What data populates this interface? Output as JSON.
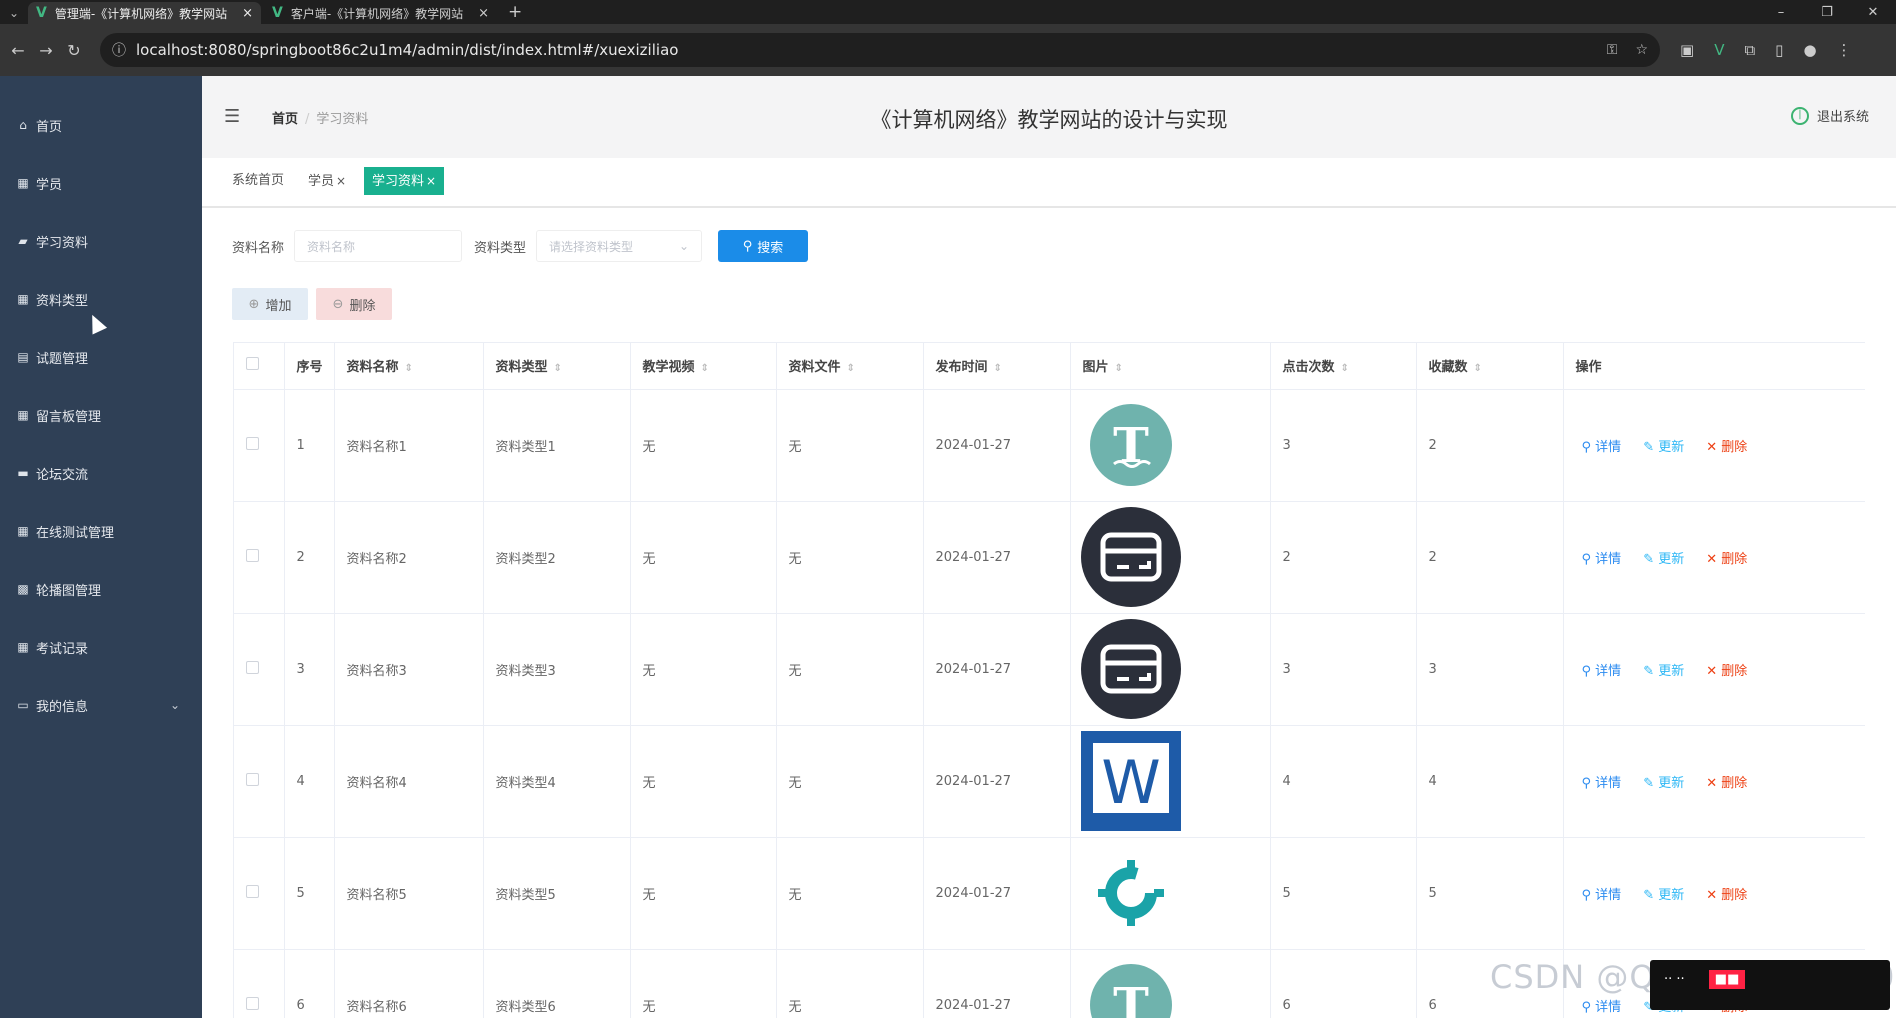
{
  "browser": {
    "tabs": [
      {
        "title": "管理端-《计算机网络》教学网站"
      },
      {
        "title": "客户端-《计算机网络》教学网站"
      }
    ],
    "url": "localhost:8080/springboot86c2u1m4/admin/dist/index.html#/xuexiziliao"
  },
  "sidebar": {
    "items": [
      {
        "label": "首页",
        "icon": "home-icon"
      },
      {
        "label": "学员",
        "icon": "grid-icon"
      },
      {
        "label": "学习资料",
        "icon": "book-icon"
      },
      {
        "label": "资料类型",
        "icon": "grid-icon"
      },
      {
        "label": "试题管理",
        "icon": "clipboard-icon"
      },
      {
        "label": "留言板管理",
        "icon": "grid-icon"
      },
      {
        "label": "论坛交流",
        "icon": "monitor-icon"
      },
      {
        "label": "在线测试管理",
        "icon": "grid-icon"
      },
      {
        "label": "轮播图管理",
        "icon": "image-icon"
      },
      {
        "label": "考试记录",
        "icon": "grid-icon"
      },
      {
        "label": "我的信息",
        "icon": "id-card-icon"
      }
    ]
  },
  "header": {
    "breadcrumb": {
      "home": "首页",
      "current": "学习资料"
    },
    "title": "《计算机网络》教学网站的设计与实现",
    "logout": "退出系统"
  },
  "tags": [
    {
      "label": "系统首页"
    },
    {
      "label": "学员"
    },
    {
      "label": "学习资料"
    }
  ],
  "search": {
    "name_label": "资料名称",
    "name_placeholder": "资料名称",
    "type_label": "资料类型",
    "type_placeholder": "请选择资料类型",
    "button": "搜索"
  },
  "actions": {
    "add": "增加",
    "delete": "删除"
  },
  "table": {
    "columns": [
      "序号",
      "资料名称",
      "资料类型",
      "教学视频",
      "资料文件",
      "发布时间",
      "图片",
      "点击次数",
      "收藏数",
      "操作"
    ],
    "op_labels": {
      "view": "详情",
      "update": "更新",
      "delete": "删除"
    },
    "rows": [
      {
        "no": "1",
        "name": "资料名称1",
        "type": "资料类型1",
        "video": "无",
        "file": "无",
        "date": "2024-01-27",
        "image": "t-logo",
        "clicks": "3",
        "favs": "2"
      },
      {
        "no": "2",
        "name": "资料名称2",
        "type": "资料类型2",
        "video": "无",
        "file": "无",
        "date": "2024-01-27",
        "image": "card-logo",
        "clicks": "2",
        "favs": "2"
      },
      {
        "no": "3",
        "name": "资料名称3",
        "type": "资料类型3",
        "video": "无",
        "file": "无",
        "date": "2024-01-27",
        "image": "card-logo",
        "clicks": "3",
        "favs": "3"
      },
      {
        "no": "4",
        "name": "资料名称4",
        "type": "资料类型4",
        "video": "无",
        "file": "无",
        "date": "2024-01-27",
        "image": "word-logo",
        "clicks": "4",
        "favs": "4"
      },
      {
        "no": "5",
        "name": "资料名称5",
        "type": "资料类型5",
        "video": "无",
        "file": "无",
        "date": "2024-01-27",
        "image": "gear-logo",
        "clicks": "5",
        "favs": "5"
      },
      {
        "no": "6",
        "name": "资料名称6",
        "type": "资料类型6",
        "video": "无",
        "file": "无",
        "date": "2024-01-27",
        "image": "t-logo",
        "clicks": "6",
        "favs": "6"
      }
    ]
  },
  "colors": {
    "sidebar": "#2f4056",
    "accent": "#19b08f",
    "primary": "#1b8ce8"
  }
}
